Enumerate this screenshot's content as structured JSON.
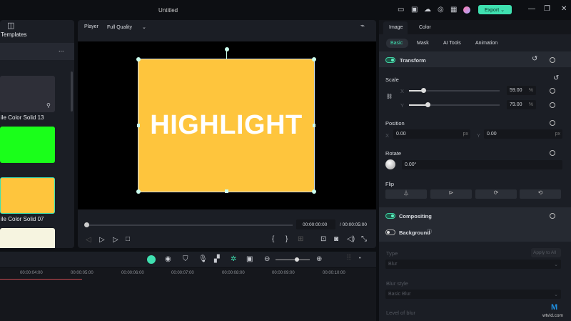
{
  "titlebar": {
    "title": "Untitled",
    "export_label": "Export",
    "icons": [
      "layout-icon",
      "save-icon",
      "cloud-upload-icon",
      "headset-icon",
      "qr-icon",
      "avatar"
    ]
  },
  "left_panel": {
    "tab_label": "Templates",
    "more": "...",
    "items": [
      {
        "label": "ile Color Solid 13",
        "color": "#2e2f38"
      },
      {
        "label": "",
        "color": "#1aff1a"
      },
      {
        "label": "ile Color Solid 07",
        "color": "#fec53d"
      },
      {
        "label": "",
        "color": "#f6f4e0"
      }
    ]
  },
  "player": {
    "label": "Player",
    "quality": "Full Quality",
    "overlay_text": "HIGHLIGHT",
    "clip_color": "#fec53d",
    "current_time": "00:00:00:00",
    "total_time": "/ 00:00:05:00",
    "progress": 0
  },
  "timeline": {
    "ticks": [
      "00:00:04:00",
      "00:00:05:00",
      "00:00:06:00",
      "00:00:07:00",
      "00:00:08:00",
      "00:00:09:00",
      "00:00:10:00"
    ],
    "zoom_level": 0.6
  },
  "inspector": {
    "tabs": [
      "Image",
      "Color"
    ],
    "subtabs": [
      "Basic",
      "Mask",
      "AI Tools",
      "Animation"
    ],
    "transform": "Transform",
    "scale": "Scale",
    "scale_x": "59.00",
    "scale_y": "79.00",
    "pct": "%",
    "x": "X",
    "y": "Y",
    "position": "Position",
    "pos_x": "0.00",
    "pos_y": "0.00",
    "px": "px",
    "rotate": "Rotate",
    "rotate_value": "0.00°",
    "flip": "Flip",
    "compositing": "Compositing",
    "background": "Background",
    "type": "Type",
    "apply_all": "Apply to All",
    "type_value": "Blur",
    "blur_style": "Blur style",
    "blur_style_value": "Basic Blur",
    "level": "Level of blur"
  },
  "watermark": "wtvid.com",
  "accent": "#3fe0b0"
}
